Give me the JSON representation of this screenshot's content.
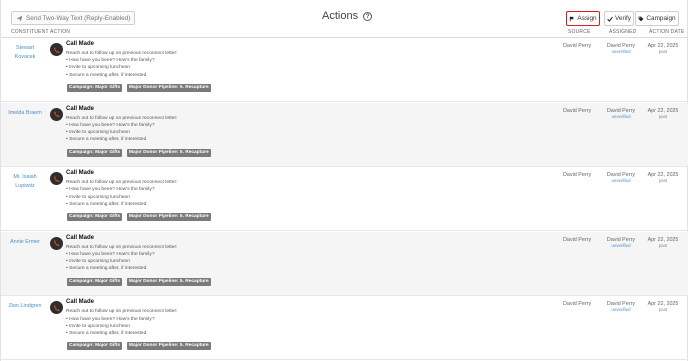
{
  "header": {
    "sms_button": "Send Two-Way Text (Reply-Enabled)",
    "title": "Actions",
    "help": "?",
    "assign_button": "Assign",
    "verify_button": "Verify",
    "campaign_button": "Campaign"
  },
  "columns": {
    "constituent": "CONSTITUENT",
    "action": "ACTION",
    "source": "SOURCE",
    "assigned": "ASSIGNED",
    "date": "ACTION DATE"
  },
  "rows": [
    {
      "constituent": "Stewart Kovacek",
      "title": "Call Made",
      "intro": "Reach out to follow up on previous reconnect letter:",
      "bullets": [
        "How have you been? How's the family?",
        "Invite to upcoming luncheon",
        "Secure a meeting after, if interested"
      ],
      "tags": [
        "Campaign: Major Gifts",
        "Major Donor Pipeline: 5. Recapture"
      ],
      "source": "David Perry",
      "assigned": "David Perry",
      "assigned_status": "unverified",
      "date": "Apr 22, 2025",
      "date_status": "past"
    },
    {
      "constituent": "Imelda Braem",
      "title": "Call Made",
      "intro": "Reach out to follow up on previous reconnect letter:",
      "bullets": [
        "How have you been? How's the family?",
        "Invite to upcoming luncheon",
        "Secure a meeting after, if interested"
      ],
      "tags": [
        "Campaign: Major Gifts",
        "Major Donor Pipeline: 5. Recapture"
      ],
      "source": "David Perry",
      "assigned": "David Perry",
      "assigned_status": "unverified",
      "date": "Apr 22, 2025",
      "date_status": "past"
    },
    {
      "constituent": "Mr. Isaiah Lupiwitz",
      "title": "Call Made",
      "intro": "Reach out to follow up on previous reconnect letter:",
      "bullets": [
        "How have you been? How's the family?",
        "Invite to upcoming luncheon",
        "Secure a meeting after, if interested"
      ],
      "tags": [
        "Campaign: Major Gifts",
        "Major Donor Pipeline: 5. Recapture"
      ],
      "source": "David Perry",
      "assigned": "David Perry",
      "assigned_status": "unverified",
      "date": "Apr 22, 2025",
      "date_status": "past"
    },
    {
      "constituent": "Annie Ermer",
      "title": "Call Made",
      "intro": "Reach out to follow up on previous reconnect letter:",
      "bullets": [
        "How have you been? How's the family?",
        "Invite to upcoming luncheon",
        "Secure a meeting after, if interested"
      ],
      "tags": [
        "Campaign: Major Gifts",
        "Major Donor Pipeline: 5. Recapture"
      ],
      "source": "David Perry",
      "assigned": "David Perry",
      "assigned_status": "unverified",
      "date": "Apr 22, 2025",
      "date_status": "past"
    },
    {
      "constituent": "Zion Lindgren",
      "title": "Call Made",
      "intro": "Reach out to follow up on previous reconnect letter:",
      "bullets": [
        "How have you been? How's the family?",
        "Invite to upcoming luncheon",
        "Secure a meeting after, if interested"
      ],
      "tags": [
        "Campaign: Major Gifts",
        "Major Donor Pipeline: 5. Recapture"
      ],
      "source": "David Perry",
      "assigned": "David Perry",
      "assigned_status": "unverified",
      "date": "Apr 22, 2025",
      "date_status": "past"
    }
  ],
  "icons": {
    "sms": "send-icon",
    "assign": "flag-icon",
    "verify": "check-icon",
    "campaign": "tag-icon",
    "action": "phone-icon"
  },
  "colors": {
    "link": "#4a90c8",
    "assign_outline": "#d32020",
    "tag_bg": "#7a7a7a",
    "action_icon_bg": "#2e2e2e",
    "phone_glyph": "#e04a2a"
  }
}
